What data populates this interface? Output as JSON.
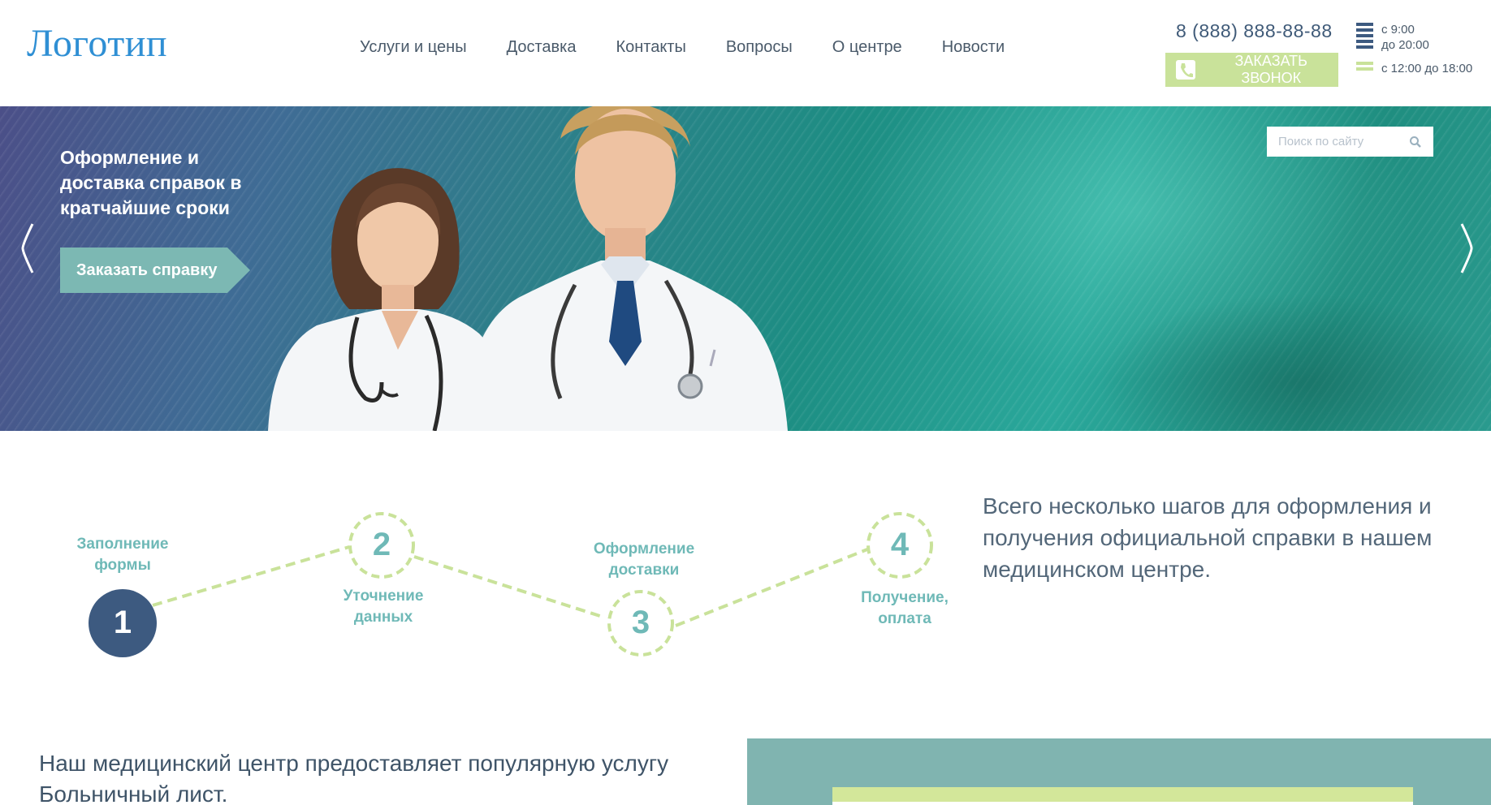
{
  "header": {
    "logo": "Логотип",
    "nav": [
      {
        "label": "Услуги и цены"
      },
      {
        "label": "Доставка"
      },
      {
        "label": "Контакты"
      },
      {
        "label": "Вопросы"
      },
      {
        "label": "О центре"
      },
      {
        "label": "Новости"
      }
    ],
    "phone": "8 (888) 888-88-88",
    "callback_label": "ЗАКАЗАТЬ ЗВОНОК",
    "hours": {
      "weekday_from": "с 9:00",
      "weekday_to": "до 20:00",
      "weekend": "с 12:00 до 18:00"
    }
  },
  "hero": {
    "title": "Оформление и доставка справок в кратчайшие сроки",
    "cta_label": "Заказать справку",
    "search_placeholder": "Поиск по сайту"
  },
  "steps": {
    "items": [
      {
        "number": "1",
        "label_line1": "Заполнение",
        "label_line2": "формы"
      },
      {
        "number": "2",
        "label_line1": "Уточнение",
        "label_line2": "данных"
      },
      {
        "number": "3",
        "label_line1": "Оформление",
        "label_line2": "доставки"
      },
      {
        "number": "4",
        "label_line1": "Получение,",
        "label_line2": "оплата"
      }
    ],
    "description": "Всего несколько шагов для оформления и получения официальной справки в нашем медицинском центре."
  },
  "bottom": {
    "intro": "Наш медицинский центр предоставляет популярную услугу Больничный лист."
  },
  "colors": {
    "accent_blue": "#2f8fd4",
    "light_green": "#c9e29a",
    "teal": "#6fb9b7",
    "dark_navy": "#3d5a80"
  }
}
